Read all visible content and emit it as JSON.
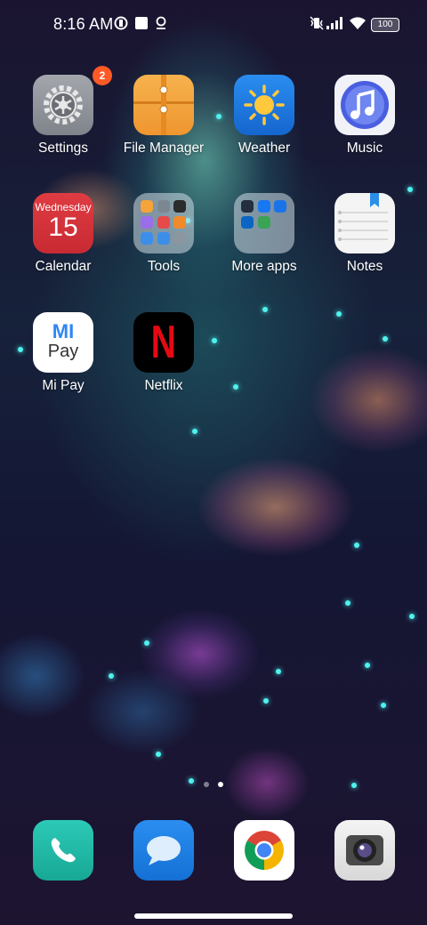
{
  "status_bar": {
    "time": "8:16 AM",
    "battery": "100"
  },
  "apps": [
    {
      "name": "Settings",
      "badge": "2",
      "icon": "gear-icon"
    },
    {
      "name": "File Manager",
      "icon": "folder-envelope-icon"
    },
    {
      "name": "Weather",
      "icon": "sun-icon"
    },
    {
      "name": "Music",
      "icon": "music-note-icon"
    },
    {
      "name": "Calendar",
      "day": "Wednesday",
      "date": "15",
      "icon": "calendar-icon"
    },
    {
      "name": "Tools",
      "icon": "folder-icon"
    },
    {
      "name": "More apps",
      "icon": "folder-icon"
    },
    {
      "name": "Notes",
      "icon": "notepad-icon"
    },
    {
      "name": "Mi Pay",
      "logo_top": "MI",
      "logo_bottom": "Pay",
      "icon": "mi-pay-icon"
    },
    {
      "name": "Netflix",
      "logo": "N",
      "icon": "netflix-icon"
    }
  ],
  "dock": [
    {
      "name": "Phone",
      "icon": "phone-icon"
    },
    {
      "name": "Messages",
      "icon": "chat-bubble-icon"
    },
    {
      "name": "Chrome",
      "icon": "chrome-icon"
    },
    {
      "name": "Camera",
      "icon": "camera-icon"
    }
  ],
  "page_indicator": {
    "pages": 2,
    "current": 2
  },
  "colors": {
    "badge": "#ff5a26",
    "settings_bg": "#8e9299",
    "file_manager_bg": "#f2a13c",
    "weather_bg": "#1f7be0",
    "music_bg": "#f0f2f8",
    "calendar_bg": "#d6333a",
    "notes_bg": "#f4f4f4",
    "phone_bg": "#22b9a8",
    "messages_bg": "#1f7fe0",
    "netflix_red": "#e50914"
  }
}
